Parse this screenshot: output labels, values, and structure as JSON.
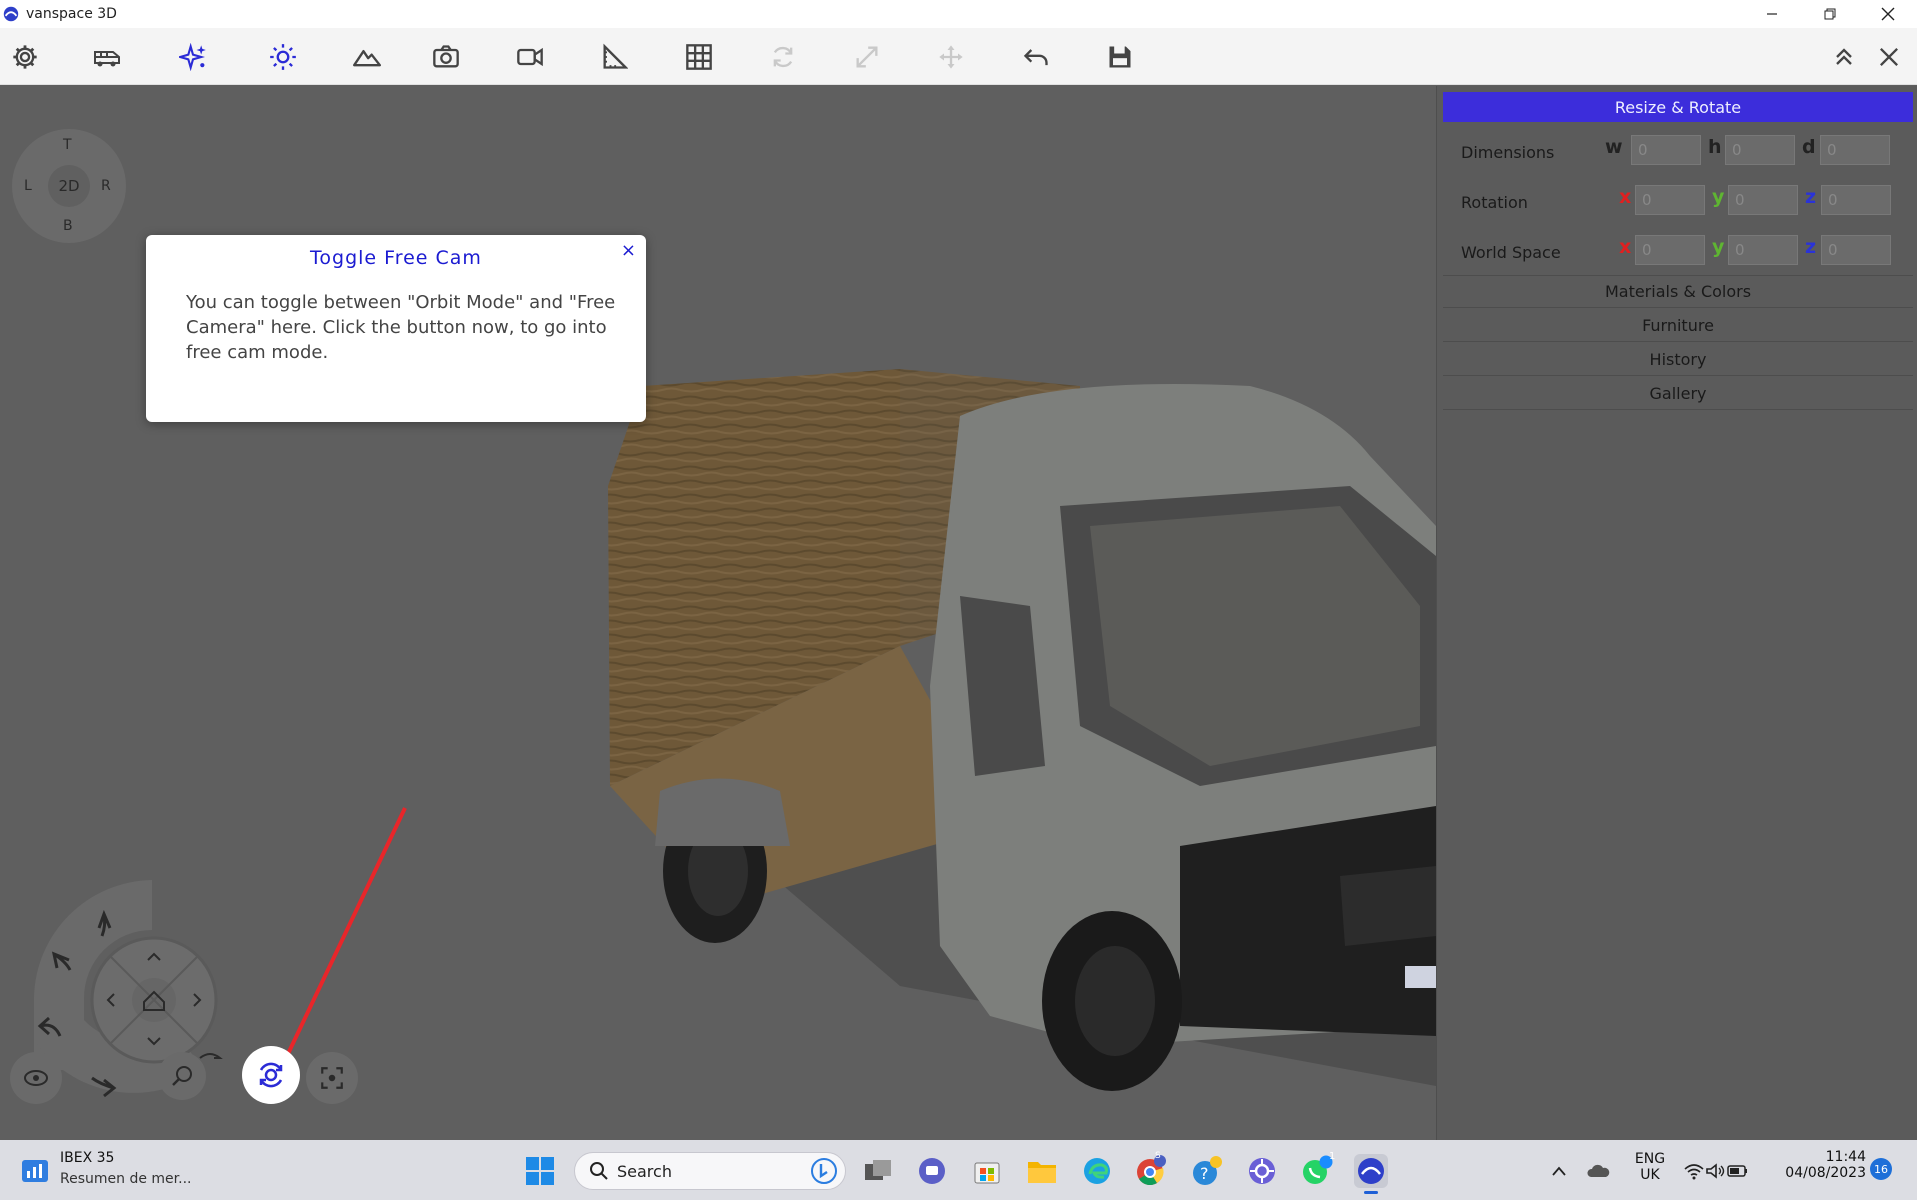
{
  "window": {
    "title": "vanspace 3D"
  },
  "tooltip": {
    "title": "Toggle Free Cam",
    "body": "You can toggle between \"Orbit Mode\" and \"Free Camera\" here. Click the button now, to go into free cam mode.",
    "close": "×"
  },
  "compass": {
    "top": "T",
    "left": "L",
    "center": "2D",
    "right": "R",
    "bottom": "B"
  },
  "panel": {
    "header": "Resize & Rotate",
    "dimensions": {
      "label": "Dimensions",
      "axes": [
        "w",
        "h",
        "d"
      ],
      "values": [
        "0",
        "0",
        "0"
      ]
    },
    "rotation": {
      "label": "Rotation",
      "axes": [
        "x",
        "y",
        "z"
      ],
      "values": [
        "0",
        "0",
        "0"
      ]
    },
    "world_space": {
      "label": "World Space",
      "axes": [
        "x",
        "y",
        "z"
      ],
      "values": [
        "0",
        "0",
        "0"
      ]
    },
    "sections": [
      "Materials & Colors",
      "Furniture",
      "History",
      "Gallery"
    ]
  },
  "colors": {
    "accent": "#3c2ddb",
    "axis_x": "#e02020",
    "axis_y": "#5fb532",
    "axis_z": "#2a33d8",
    "arrow": "#e8262a"
  },
  "taskbar": {
    "news_title": "IBEX 35",
    "news_sub": "Resumen de mer...",
    "search_placeholder": "Search",
    "lang_top": "ENG",
    "lang_bottom": "UK",
    "time": "11:44",
    "date": "04/08/2023",
    "notifications": "16",
    "chrome_badge": "S",
    "whatsapp_badge": "1"
  }
}
